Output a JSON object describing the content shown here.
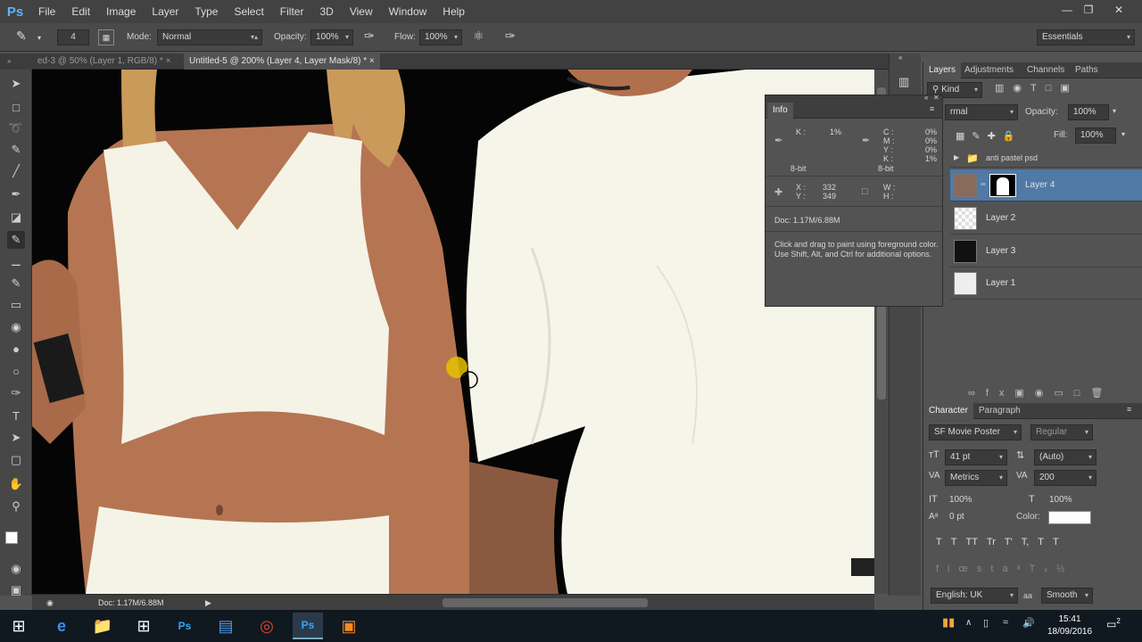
{
  "app": {
    "logo": "Ps"
  },
  "menu": [
    "File",
    "Edit",
    "Image",
    "Layer",
    "Type",
    "Select",
    "Filter",
    "3D",
    "View",
    "Window",
    "Help"
  ],
  "window_controls": [
    "minimize-icon",
    "restore-icon",
    "close-icon"
  ],
  "options": {
    "brush_size": "4",
    "mode_label": "Mode:",
    "mode_value": "Normal",
    "opacity_label": "Opacity:",
    "opacity_value": "100%",
    "flow_label": "Flow:",
    "flow_value": "100%",
    "workspace": "Essentials"
  },
  "doc_tabs": [
    {
      "title": "ed-3 @ 50% (Layer 1, RGB/8) *",
      "active": false
    },
    {
      "title": "Untitled-5 @ 200% (Layer 4, Layer Mask/8) *",
      "active": true
    }
  ],
  "status": {
    "doc": "Doc: 1.17M/6.88M"
  },
  "info": {
    "title": "Info",
    "k_label": "K :",
    "k_value": "1%",
    "bitdepth_left": "8-bit",
    "cmyk_labels": [
      "C :",
      "M :",
      "Y :",
      "K :"
    ],
    "cmyk_values": [
      "0%",
      "0%",
      "0%",
      "1%"
    ],
    "bitdepth_right": "8-bit",
    "x_label": "X :",
    "x_value": "332",
    "y_label": "Y :",
    "y_value": "349",
    "w_label": "W :",
    "h_label": "H :",
    "doc": "Doc: 1.17M/6.88M",
    "hint": "Click and drag to paint using foreground color.  Use Shift, Alt, and Ctrl for additional options."
  },
  "layers_panel": {
    "tabs": [
      "Layers",
      "Adjustments",
      "Channels",
      "Paths"
    ],
    "kind": "Kind",
    "blend": "rmal",
    "opacity_label": "Opacity:",
    "opacity_value": "100%",
    "fill_label": "Fill:",
    "fill_value": "100%",
    "group_name": "anti pastel psd",
    "layers": [
      "Layer 4",
      "Layer 2",
      "Layer 3",
      "Layer 1"
    ]
  },
  "character": {
    "tabs": [
      "Character",
      "Paragraph"
    ],
    "font": "SF Movie Poster",
    "style": "Regular",
    "size": "41 pt",
    "leading": "(Auto)",
    "kerning": "Metrics",
    "tracking": "200",
    "vscale": "100%",
    "hscale": "100%",
    "baseline": "0 pt",
    "color_label": "Color:",
    "color": "#ffffff",
    "language": "English: UK",
    "aa_label": "aa",
    "antialias": "Smooth",
    "typestyles": [
      "T",
      "T",
      "TT",
      "Tr",
      "T'",
      "T,",
      "T",
      "T"
    ]
  },
  "taskbar": {
    "time": "15:41",
    "date": "18/09/2016",
    "notif_count": "2"
  },
  "colors": {
    "accent": "#5ab3ff",
    "selection": "#5079a6"
  }
}
